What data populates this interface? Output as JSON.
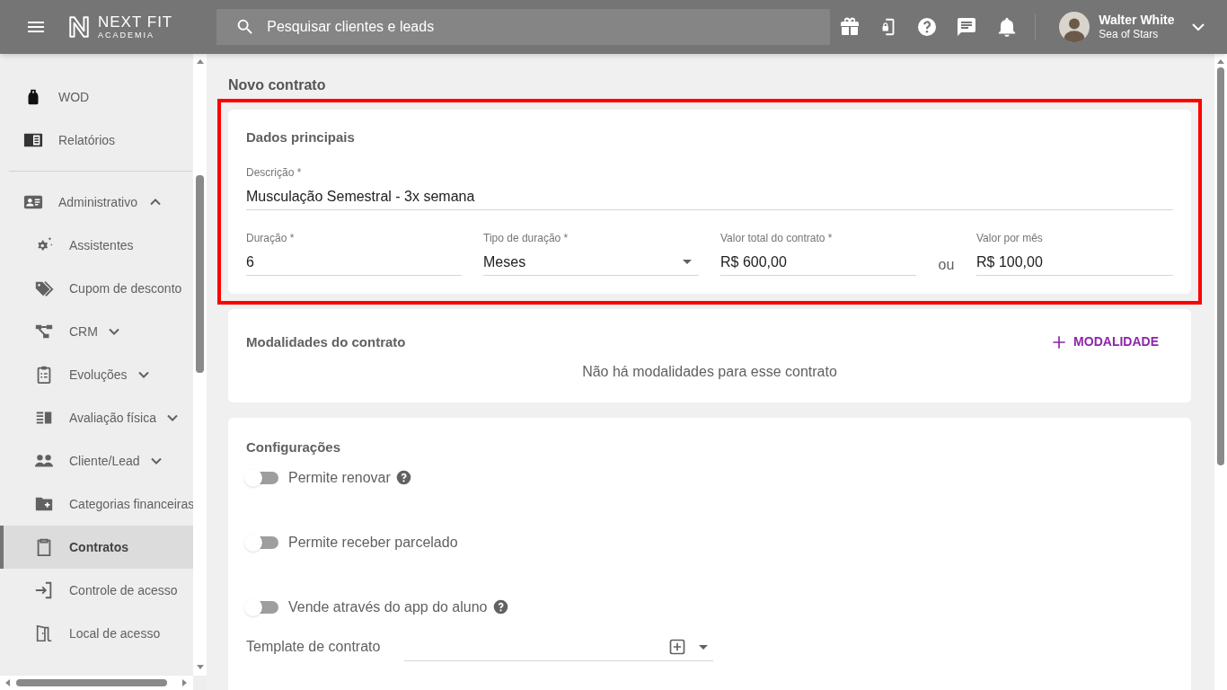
{
  "header": {
    "logo": {
      "title": "NEXT FIT",
      "subtitle": "ACADEMIA"
    },
    "search": {
      "placeholder": "Pesquisar clientes e leads"
    },
    "user": {
      "name": "Walter White",
      "organization": "Sea of Stars"
    }
  },
  "sidebar": {
    "items": [
      {
        "label": "WOD",
        "kind": "main",
        "selected": false
      },
      {
        "label": "Relatórios",
        "kind": "main",
        "selected": false
      },
      {
        "kind": "divider"
      },
      {
        "label": "Administrativo",
        "kind": "main",
        "expanded": true,
        "selected": false,
        "children": [
          {
            "label": "Assistentes",
            "kind": "sub",
            "selected": false
          },
          {
            "label": "Cupom de desconto",
            "kind": "sub",
            "selected": false
          },
          {
            "label": "CRM",
            "kind": "sub",
            "expanded": false,
            "selected": false
          },
          {
            "label": "Evoluções",
            "kind": "sub",
            "expanded": false,
            "selected": false
          },
          {
            "label": "Avaliação física",
            "kind": "sub",
            "expanded": false,
            "selected": false
          },
          {
            "label": "Cliente/Lead",
            "kind": "sub",
            "expanded": false,
            "selected": false
          },
          {
            "label": "Categorias financeiras",
            "kind": "sub",
            "selected": false
          },
          {
            "label": "Contratos",
            "kind": "sub",
            "selected": true
          },
          {
            "label": "Controle de acesso",
            "kind": "sub",
            "selected": false
          },
          {
            "label": "Local de acesso",
            "kind": "sub",
            "selected": false
          }
        ]
      }
    ]
  },
  "page_title": "Novo contrato",
  "main_data": {
    "title": "Dados principais",
    "highlighted": true,
    "description": {
      "label": "Descrição *",
      "value": "Musculação Semestral - 3x semana"
    },
    "fields": [
      {
        "label": "Duração *",
        "value": "6",
        "kind": "text"
      },
      {
        "label": "Tipo de duração *",
        "value": "Meses",
        "kind": "select"
      },
      {
        "label": "Valor total do contrato *",
        "value": "R$ 600,00",
        "kind": "text"
      },
      {
        "label": "Valor por mês",
        "value": "R$ 100,00",
        "kind": "text"
      }
    ],
    "separator": "ou"
  },
  "modalities": {
    "title": "Modalidades do contrato",
    "add_button": "MODALIDADE",
    "empty_message": "Não há modalidades para esse contrato"
  },
  "settings": {
    "title": "Configurações",
    "toggles": [
      {
        "label": "Permite renovar",
        "on": false,
        "help": true
      },
      {
        "label": "Permite receber parcelado",
        "on": false
      },
      {
        "label": "Vende através do app do aluno",
        "on": false,
        "help": true
      }
    ],
    "template": {
      "label": "Template de contrato"
    }
  }
}
